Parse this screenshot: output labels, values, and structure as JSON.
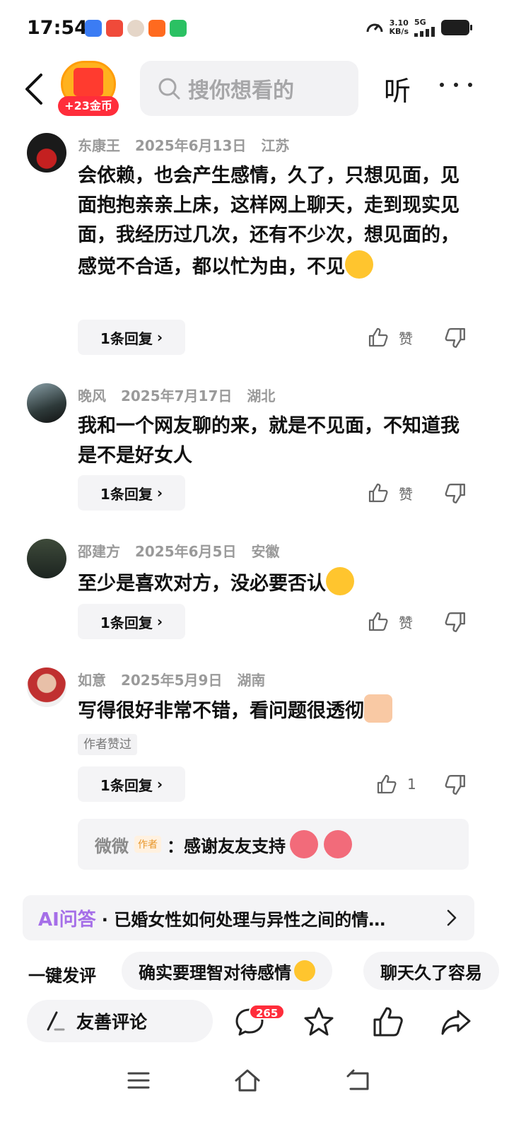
{
  "status_bar": {
    "time": "17:54",
    "net_speed_value": "3.10",
    "net_speed_unit": "KB/s",
    "network": "5G"
  },
  "header": {
    "coin_badge": "+23金币",
    "search_placeholder": "搜你想看的",
    "listen_label": "听"
  },
  "comments": [
    {
      "user": "东康王",
      "date": "2025年6月13日",
      "location": "江苏",
      "text": "会依赖，也会产生感情，久了，只想见面，见面抱抱亲亲上床，这样网上聊天，走到现实见面，我经历过几次，还有不少次，想见面的，感觉不合适，都以忙为由，不见",
      "emoji": "laughing-crying-emoji",
      "reply_count": "1条回复",
      "like_label": "赞"
    },
    {
      "user": "晚风",
      "date": "2025年7月17日",
      "location": "湖北",
      "text": "我和一个网友聊的来，就是不见面，不知道我是不是好女人",
      "reply_count": "1条回复",
      "like_label": "赞"
    },
    {
      "user": "邵建方",
      "date": "2025年6月5日",
      "location": "安徽",
      "text": "至少是喜欢对方，没必要否认",
      "emoji": "grinning-emoji",
      "reply_count": "1条回复",
      "like_label": "赞"
    },
    {
      "user": "如意",
      "date": "2025年5月9日",
      "location": "湖南",
      "text": "写得很好非常不错，看问题很透彻",
      "emoji": "thumbs-up-emoji",
      "author_liked": "作者赞过",
      "reply_count": "1条回复",
      "like_count": "1",
      "author_reply": {
        "name": "微微",
        "tag": "作者",
        "text": "：感谢友友支持",
        "emoji": "rose-emoji"
      }
    }
  ],
  "ai_qa": {
    "label": "AI问答",
    "text": "· 已婚女性如何处理与异性之间的情…"
  },
  "quick_comment": {
    "label": "一键发评",
    "chips": [
      "确实要理智对待感情",
      "聊天久了容易"
    ]
  },
  "action_bar": {
    "comment_placeholder": "友善评论",
    "comment_count": "265"
  },
  "colors": {
    "ai_purple": "#a56ee8",
    "badge_red": "#ff2d3b",
    "chip_bg": "#f4f4f6"
  }
}
